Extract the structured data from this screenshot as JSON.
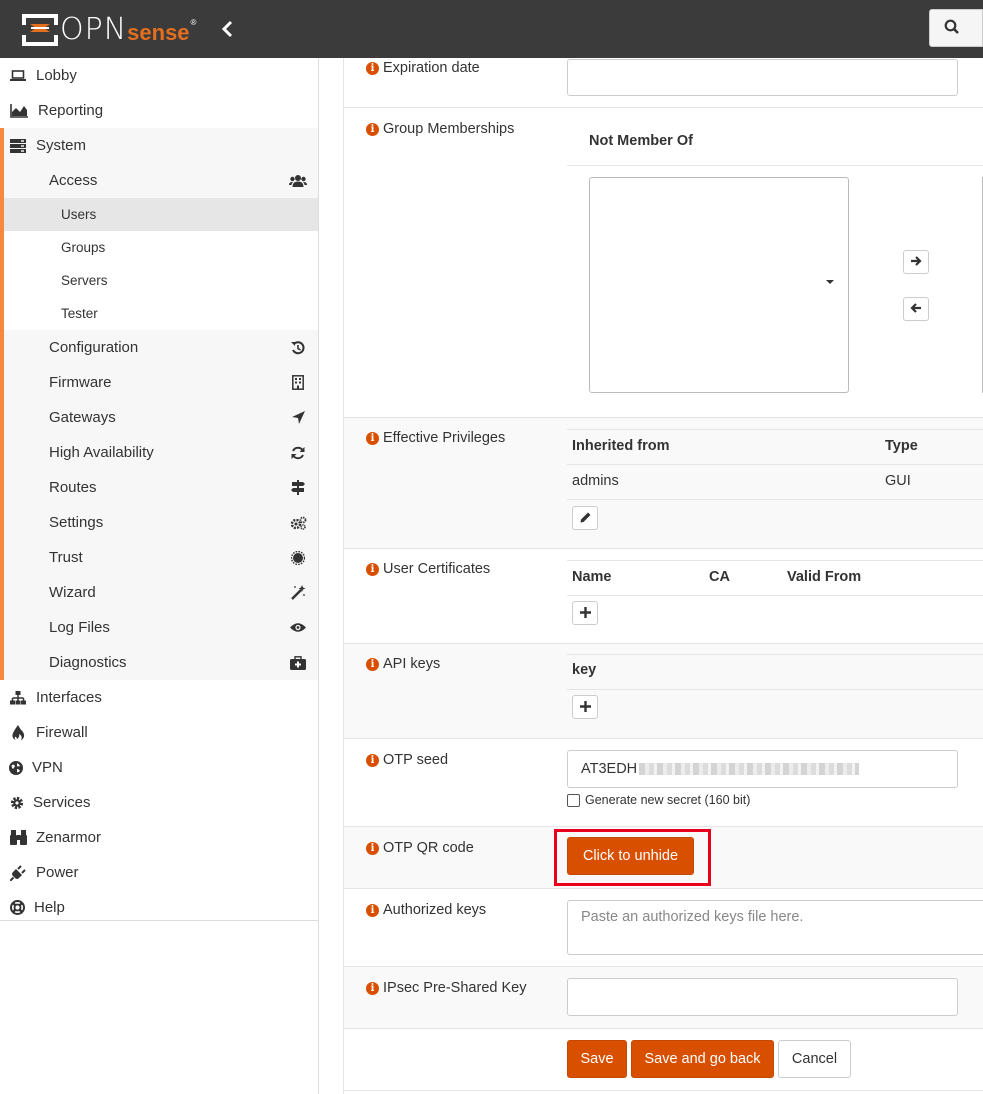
{
  "header": {
    "logo_opn": "OPN",
    "logo_sense": "sense",
    "logo_reg": "®",
    "collapse_icon": "chevron-left-icon",
    "search_icon": "search-icon"
  },
  "sidebar": {
    "top_items": [
      {
        "label": "Lobby",
        "icon": "laptop-icon"
      },
      {
        "label": "Reporting",
        "icon": "area-chart-icon"
      },
      {
        "label": "System",
        "icon": "server-icon"
      }
    ],
    "system_items": [
      {
        "label": "Access",
        "icon": "users-icon"
      },
      {
        "label": "Users"
      },
      {
        "label": "Groups"
      },
      {
        "label": "Servers"
      },
      {
        "label": "Tester"
      },
      {
        "label": "Configuration",
        "icon": "history-icon"
      },
      {
        "label": "Firmware",
        "icon": "building-icon"
      },
      {
        "label": "Gateways",
        "icon": "location-arrow-icon"
      },
      {
        "label": "High Availability",
        "icon": "refresh-icon"
      },
      {
        "label": "Routes",
        "icon": "map-signs-icon"
      },
      {
        "label": "Settings",
        "icon": "cogs-icon"
      },
      {
        "label": "Trust",
        "icon": "certificate-icon"
      },
      {
        "label": "Wizard",
        "icon": "magic-icon"
      },
      {
        "label": "Log Files",
        "icon": "eye-icon"
      },
      {
        "label": "Diagnostics",
        "icon": "medkit-icon"
      }
    ],
    "bottom_items": [
      {
        "label": "Interfaces",
        "icon": "sitemap-icon"
      },
      {
        "label": "Firewall",
        "icon": "fire-icon"
      },
      {
        "label": "VPN",
        "icon": "globe-icon"
      },
      {
        "label": "Services",
        "icon": "cog-icon"
      },
      {
        "label": "Zenarmor",
        "icon": "binoculars-icon"
      },
      {
        "label": "Power",
        "icon": "plug-icon"
      },
      {
        "label": "Help",
        "icon": "life-ring-icon"
      }
    ]
  },
  "form": {
    "expiration": {
      "label": "Expiration date",
      "value": ""
    },
    "groups": {
      "label": "Group Memberships",
      "not_member_header": "Not Member Of"
    },
    "privileges": {
      "label": "Effective Privileges",
      "col_inherited": "Inherited from",
      "col_type": "Type",
      "rows": [
        {
          "inherited": "admins",
          "type": "GUI"
        }
      ]
    },
    "certificates": {
      "label": "User Certificates",
      "col_name": "Name",
      "col_ca": "CA",
      "col_valid_from": "Valid From"
    },
    "api_keys": {
      "label": "API keys",
      "col_key": "key"
    },
    "otp_seed": {
      "label": "OTP seed",
      "value": "AT3EDH",
      "checkbox_label": "Generate new secret (160 bit)"
    },
    "otp_qr": {
      "label": "OTP QR code",
      "button": "Click to unhide"
    },
    "authorized_keys": {
      "label": "Authorized keys",
      "placeholder": "Paste an authorized keys file here."
    },
    "ipsec_psk": {
      "label": "IPsec Pre-Shared Key",
      "value": ""
    },
    "actions": {
      "save": "Save",
      "save_back": "Save and go back",
      "cancel": "Cancel"
    }
  },
  "colors": {
    "accent": "#d94f00",
    "highlight_box": "#e8001c",
    "topbar": "#3b3b3b"
  }
}
